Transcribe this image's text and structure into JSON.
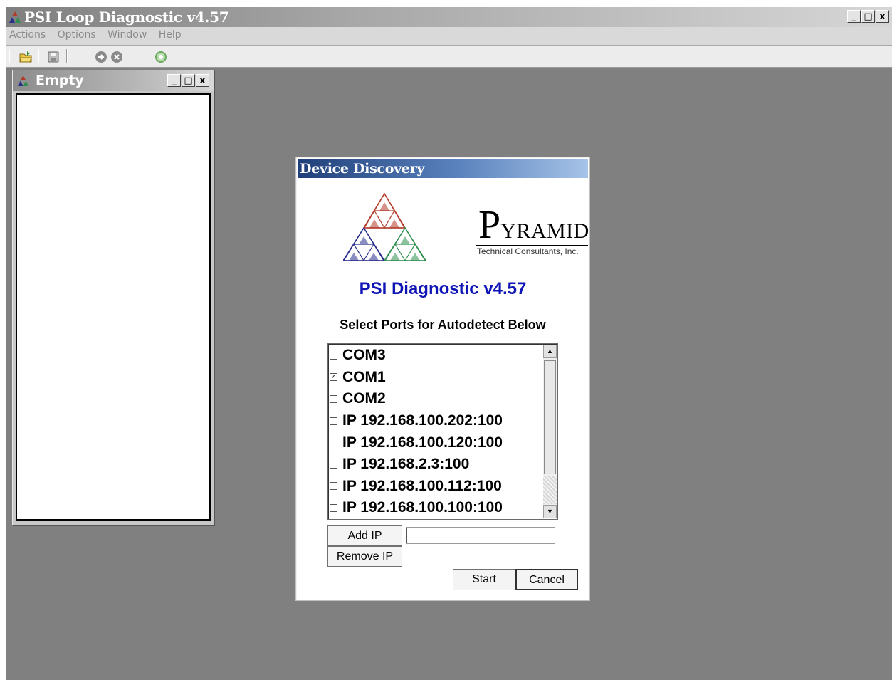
{
  "app": {
    "title": "PSI Loop Diagnostic v4.57",
    "window_controls": [
      "_",
      "□",
      "x"
    ]
  },
  "menu": [
    "Actions",
    "Options",
    "Window",
    "Help"
  ],
  "toolbar": {
    "icons": [
      "open-folder-icon",
      "save-icon",
      "connect-icon",
      "disconnect-icon",
      "refresh-icon"
    ]
  },
  "child_window": {
    "title": "Empty",
    "controls": [
      "_",
      "□",
      "x"
    ]
  },
  "dialog": {
    "title": "Device Discovery",
    "logo": {
      "company_big_letter": "P",
      "company_rest": "YRAMID",
      "tagline": "Technical Consultants, Inc."
    },
    "product": "PSI Diagnostic v4.57",
    "instruction": "Select Ports for Autodetect Below",
    "ports": [
      {
        "label": "COM3",
        "checked": false
      },
      {
        "label": "COM1",
        "checked": true
      },
      {
        "label": "COM2",
        "checked": false
      },
      {
        "label": "IP 192.168.100.202:100",
        "checked": false
      },
      {
        "label": "IP 192.168.100.120:100",
        "checked": false
      },
      {
        "label": "IP 192.168.2.3:100",
        "checked": false
      },
      {
        "label": "IP 192.168.100.112:100",
        "checked": false
      },
      {
        "label": "IP 192.168.100.100:100",
        "checked": false
      }
    ],
    "add_ip_label": "Add IP",
    "remove_ip_label": "Remove IP",
    "ip_input_value": "",
    "start_label": "Start",
    "cancel_label": "Cancel"
  },
  "colors": {
    "workspace": "#808080",
    "dialog_title_start": "#1f3f7a",
    "dialog_title_end": "#a6c3e8",
    "product_text": "#1016b5",
    "logo_red": "#b23a2a",
    "logo_blue": "#2a2f8c",
    "logo_green": "#2f8f4e"
  }
}
